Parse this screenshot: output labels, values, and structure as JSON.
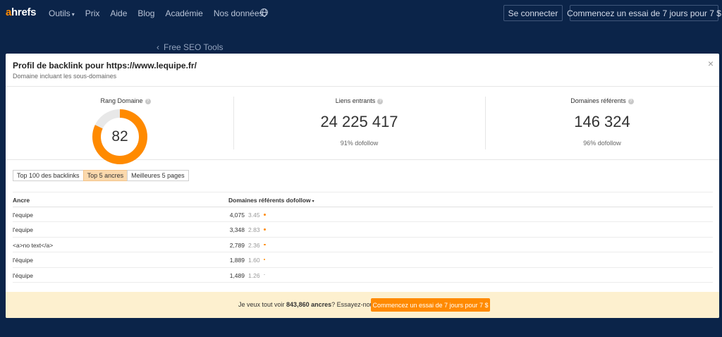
{
  "nav": {
    "logo_a": "a",
    "logo_rest": "hrefs",
    "items": [
      {
        "label": "Outils",
        "has_caret": true
      },
      {
        "label": "Prix"
      },
      {
        "label": "Aide"
      },
      {
        "label": "Blog"
      },
      {
        "label": "Académie"
      },
      {
        "label": "Nos données"
      }
    ],
    "caret": "▾",
    "connect_label": "Se connecter",
    "trial_label": "Commencez un essai de 7 jours pour 7 $"
  },
  "back_link": {
    "chevron": "‹",
    "label": "Free SEO Tools"
  },
  "modal": {
    "title": "Profil de backlink pour https://www.lequipe.fr/",
    "subtitle": "Domaine incluant les sous-domaines",
    "close": "×",
    "help_glyph": "?",
    "rank": {
      "label": "Rang Domaine",
      "value": "82",
      "fill": 0.82
    },
    "backlinks": {
      "label": "Liens entrants",
      "value": "24 225 417",
      "sub": "91% dofollow"
    },
    "ref_domains": {
      "label": "Domaines référents",
      "value": "146 324",
      "sub": "96% dofollow"
    },
    "tabs": [
      {
        "label": "Top 100 des backlinks",
        "active": false
      },
      {
        "label": "Top 5 ancres",
        "active": true
      },
      {
        "label": "Meilleures 5 pages",
        "active": false
      }
    ],
    "table": {
      "col_anchor": "Ancre",
      "col_domains": "Domaines référents dofollow",
      "sort_caret": "▾",
      "rows": [
        {
          "anchor": "l'equipe",
          "domains": "4,075",
          "ratio": "3.45"
        },
        {
          "anchor": "l'equipe",
          "domains": "3,348",
          "ratio": "2.83"
        },
        {
          "anchor": "<a>no text</a>",
          "domains": "2,789",
          "ratio": "2.36"
        },
        {
          "anchor": "l'équipe",
          "domains": "1,889",
          "ratio": "1.60"
        },
        {
          "anchor": "l'équipe",
          "domains": "1,489",
          "ratio": "1.26"
        }
      ]
    },
    "footer": {
      "text_before": "Je veux tout voir ",
      "text_bold": "843,860 ancres",
      "text_after": "? Essayez-nous.",
      "button": "Commencez un essai de 7 jours pour 7 $"
    }
  },
  "colors": {
    "accent": "#ff8a00",
    "nav_bg": "#0b2449",
    "active_tab": "#fbd9ad",
    "footer_bg": "#fdf0cf"
  }
}
